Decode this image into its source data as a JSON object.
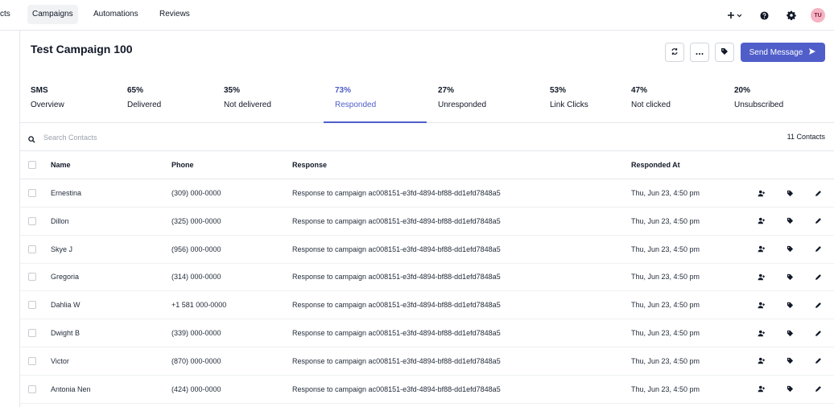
{
  "nav": {
    "items": [
      {
        "label": "cts",
        "key": "contacts",
        "active": false
      },
      {
        "label": "Campaigns",
        "key": "campaigns",
        "active": true
      },
      {
        "label": "Automations",
        "key": "automations",
        "active": false
      },
      {
        "label": "Reviews",
        "key": "reviews",
        "active": false
      }
    ],
    "avatar_initials": "TU"
  },
  "campaign": {
    "title": "Test Campaign 100",
    "send_label": "Send Message"
  },
  "stats": [
    {
      "value": "SMS",
      "label": "Overview"
    },
    {
      "value": "65%",
      "label": "Delivered"
    },
    {
      "value": "35%",
      "label": "Not delivered"
    },
    {
      "value": "73%",
      "label": "Responded",
      "active": true
    },
    {
      "value": "27%",
      "label": "Unresponded"
    },
    {
      "value": "53%",
      "label": "Link Clicks"
    },
    {
      "value": "47%",
      "label": "Not clicked"
    },
    {
      "value": "20%",
      "label": "Unsubscribed"
    }
  ],
  "search": {
    "placeholder": "Search Contacts",
    "count": "11 Contacts"
  },
  "table": {
    "headers": {
      "name": "Name",
      "phone": "Phone",
      "response": "Response",
      "responded_at": "Responded At"
    },
    "rows": [
      {
        "name": "Ernestina",
        "phone": "(309) 000-0000",
        "response": "Response to campaign ac008151-e3fd-4894-bf88-dd1efd7848a5",
        "responded_at": "Thu, Jun 23, 4:50 pm"
      },
      {
        "name": "Dillon",
        "phone": "(325) 000-0000",
        "response": "Response to campaign ac008151-e3fd-4894-bf88-dd1efd7848a5",
        "responded_at": "Thu, Jun 23, 4:50 pm"
      },
      {
        "name": "Skye J",
        "phone": "(956) 000-0000",
        "response": "Response to campaign ac008151-e3fd-4894-bf88-dd1efd7848a5",
        "responded_at": "Thu, Jun 23, 4:50 pm"
      },
      {
        "name": "Gregoria",
        "phone": "(314) 000-0000",
        "response": "Response to campaign ac008151-e3fd-4894-bf88-dd1efd7848a5",
        "responded_at": "Thu, Jun 23, 4:50 pm"
      },
      {
        "name": "Dahlia W",
        "phone": "+1 581 000-0000",
        "response": "Response to campaign ac008151-e3fd-4894-bf88-dd1efd7848a5",
        "responded_at": "Thu, Jun 23, 4:50 pm"
      },
      {
        "name": "Dwight B",
        "phone": "(339) 000-0000",
        "response": "Response to campaign ac008151-e3fd-4894-bf88-dd1efd7848a5",
        "responded_at": "Thu, Jun 23, 4:50 pm"
      },
      {
        "name": "Victor",
        "phone": "(870) 000-0000",
        "response": "Response to campaign ac008151-e3fd-4894-bf88-dd1efd7848a5",
        "responded_at": "Thu, Jun 23, 4:50 pm"
      },
      {
        "name": "Antonia Nen",
        "phone": "(424) 000-0000",
        "response": "Response to campaign ac008151-e3fd-4894-bf88-dd1efd7848a5",
        "responded_at": "Thu, Jun 23, 4:50 pm"
      }
    ]
  },
  "icons": {
    "add": "plus-icon",
    "dropdown": "chevron-down-icon",
    "help": "help-circle-icon",
    "settings": "gear-icon",
    "refresh": "refresh-icon",
    "more": "more-horizontal-icon",
    "tag": "tag-icon",
    "send": "send-icon",
    "search": "search-icon",
    "assign": "user-plus-icon",
    "edit": "pencil-icon"
  },
  "colors": {
    "accent": "#4f5ec9",
    "avatar_bg": "#f5b3c4"
  }
}
